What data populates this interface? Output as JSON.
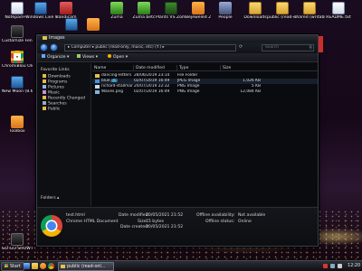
{
  "desktop": {
    "icons": [
      {
        "label": "Notepad++",
        "icon": "notepad-icon"
      },
      {
        "label": "Windows Live Mes...",
        "icon": "messenger-icon"
      },
      {
        "label": "Bandicam",
        "icon": "bandicam-icon"
      },
      {
        "label": "Zuma",
        "icon": "zuma-icon"
      },
      {
        "label": "Zuma betc",
        "icon": "zuma-icon"
      },
      {
        "label": "Plants VS Zombies",
        "icon": "game-icon"
      },
      {
        "label": "Bejeweled 2",
        "icon": "game-icon"
      },
      {
        "label": "People",
        "icon": "people-icon"
      },
      {
        "label": "Downloads",
        "icon": "folder-icon"
      },
      {
        "label": "public (read-onl...",
        "icon": "folder-icon"
      },
      {
        "label": "shared (writable)",
        "icon": "folder-icon"
      },
      {
        "label": "README.txt",
        "icon": "text-file-icon"
      },
      {
        "label": "Customize Fences",
        "icon": "fences-icon"
      },
      {
        "label": "ChromiBlou Old",
        "icon": "chrome-icon"
      },
      {
        "label": "New Moon (8.6)",
        "icon": "moon-icon"
      },
      {
        "label": "Toolbox",
        "icon": "toolbox-icon"
      },
      {
        "label": "Crack",
        "icon": "app-icon"
      },
      {
        "label": "Mozilla Thunderbird",
        "icon": "thunderbird-icon"
      },
      {
        "label": "Firefox",
        "icon": "firefox-icon"
      },
      {
        "label": "GO GO SHOWTI",
        "icon": "app-icon"
      }
    ]
  },
  "window": {
    "title": "Images",
    "address": "▸ Computer ▸ public (read-only, music, etc) (Y:) ▸",
    "search_placeholder": "Search",
    "toolbar": {
      "organize": "Organize",
      "views": "Views",
      "open": "Open"
    },
    "nav": {
      "heading": "Favorite Links",
      "items": [
        "Downloads",
        "Programs",
        "Pictures",
        "Music",
        "Recently Changed",
        "Searches",
        "Public"
      ],
      "folders_label": "Folders"
    },
    "columns": [
      "Name",
      "Date modified",
      "Type",
      "Size"
    ],
    "files": [
      {
        "name": "dancing-letters",
        "date": "28/06/2019 23:14",
        "type": "File Folder",
        "size": ""
      },
      {
        "name": "blue.jpg",
        "date": "02/07/2019 16:49",
        "type": "JPEG Image",
        "size": "1,026 KB"
      },
      {
        "name": "richard-stallman-min...",
        "date": "20/07/2019 22:32",
        "type": "PNG Image",
        "size": "5 KB"
      },
      {
        "name": "Waves.png",
        "date": "02/07/2019 16:49",
        "type": "PNG Image",
        "size": "12,084 KB"
      }
    ],
    "details": {
      "name": "test.html",
      "type": "Chrome HTML Document",
      "date_modified_label": "Date modified:",
      "date_modified": "20/05/2021 21:52",
      "size_label": "Size:",
      "size": "15 bytes",
      "date_created_label": "Date created:",
      "date_created": "20/05/2021 21:52",
      "offline_label": "Offline availability:",
      "offline": "Not available",
      "offline_status_label": "Offline status:",
      "offline_status": "Online"
    }
  },
  "taskbar": {
    "start_label": "Start",
    "task_label": "public (read-onl...",
    "clock": "12:20"
  }
}
